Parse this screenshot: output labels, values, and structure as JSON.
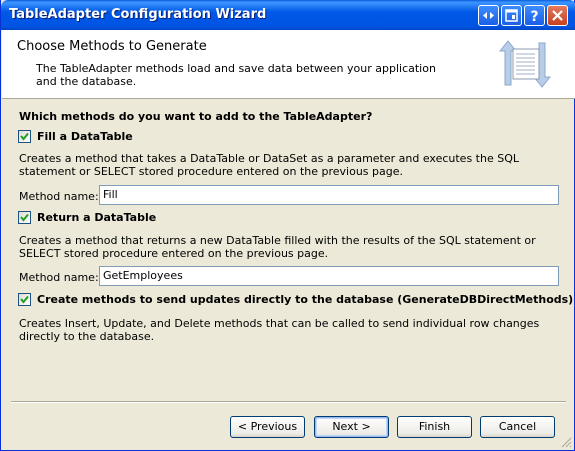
{
  "window": {
    "title": "TableAdapter Configuration Wizard",
    "buttons": [
      "expand-icon",
      "restore-icon",
      "help-icon",
      "close-icon"
    ]
  },
  "header": {
    "title": "Choose Methods to Generate",
    "description": "The TableAdapter methods load and save data between your application and the database."
  },
  "main": {
    "question": "Which methods do you want to add to the TableAdapter?",
    "fill": {
      "label": "Fill a DataTable",
      "checked": true,
      "description": "Creates a method that takes a DataTable or DataSet as a parameter and executes the SQL statement or SELECT stored procedure entered on the previous page.",
      "method_label": "Method name:",
      "method_value": "Fill"
    },
    "return": {
      "label": "Return a DataTable",
      "checked": true,
      "description": "Creates a method that returns a new DataTable filled with the results of the SQL statement or SELECT stored procedure entered on the previous page.",
      "method_label": "Method name:",
      "method_value": "GetEmployees"
    },
    "direct": {
      "label": "Create methods to send updates directly to the database (GenerateDBDirectMethods)",
      "checked": true,
      "description": "Creates Insert, Update, and Delete methods that can be called to send individual row changes directly to the database."
    }
  },
  "footer": {
    "previous": "< Previous",
    "next": "Next >",
    "finish": "Finish",
    "cancel": "Cancel"
  },
  "colors": {
    "titlebar": "#0054e3",
    "dialog_bg": "#ece9d8",
    "header_bg": "#ffffff",
    "checkmark": "#21a121"
  }
}
